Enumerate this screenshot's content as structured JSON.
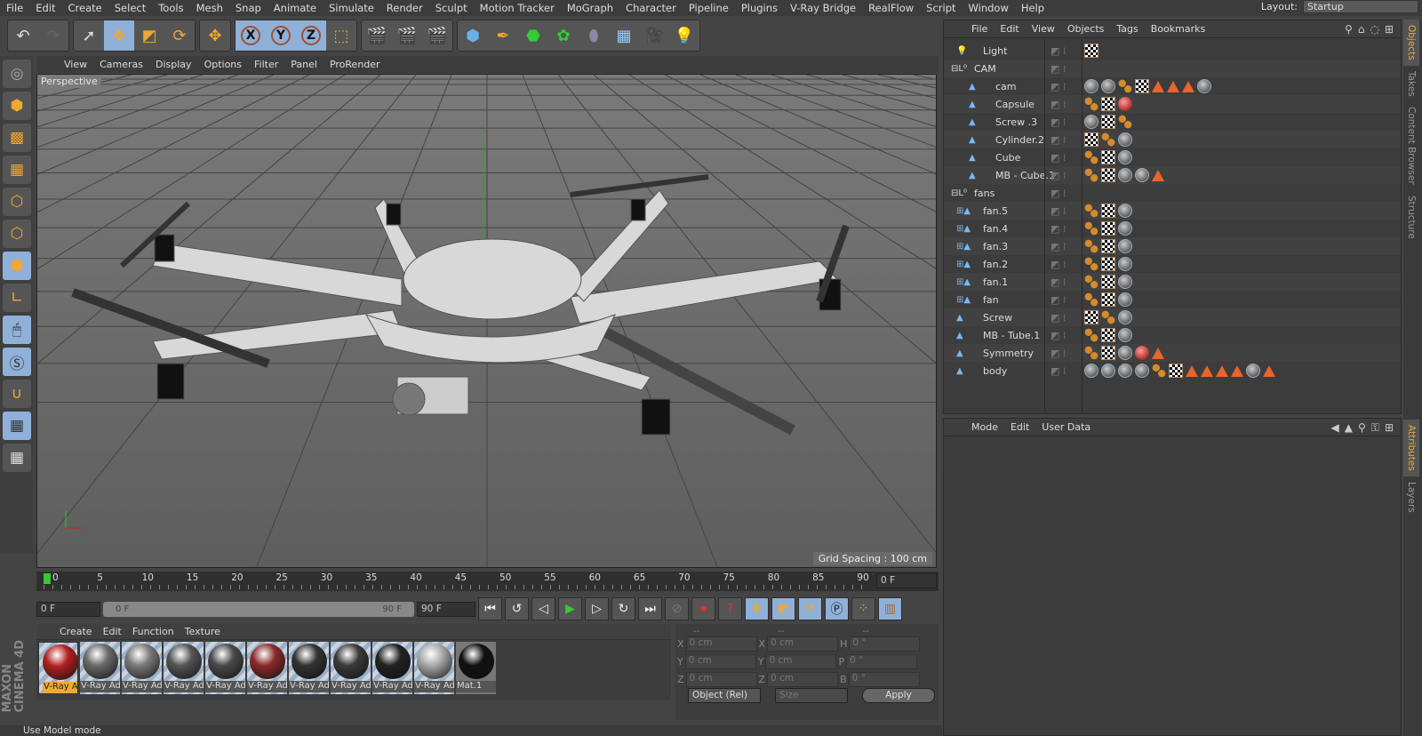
{
  "menu": [
    "File",
    "Edit",
    "Create",
    "Select",
    "Tools",
    "Mesh",
    "Snap",
    "Animate",
    "Simulate",
    "Render",
    "Sculpt",
    "Motion Tracker",
    "MoGraph",
    "Character",
    "Pipeline",
    "Plugins",
    "V-Ray Bridge",
    "RealFlow",
    "Script",
    "Window",
    "Help"
  ],
  "layout": {
    "label": "Layout:",
    "value": "Startup"
  },
  "toolbar": {
    "x": "X",
    "y": "Y",
    "z": "Z"
  },
  "viewport": {
    "menu": [
      "View",
      "Cameras",
      "Display",
      "Options",
      "Filter",
      "Panel",
      "ProRender"
    ],
    "camera": "Perspective",
    "grid_spacing": "Grid Spacing : 100 cm"
  },
  "timeline": {
    "ticks": [
      "0",
      "5",
      "10",
      "15",
      "20",
      "25",
      "30",
      "35",
      "40",
      "45",
      "50",
      "55",
      "60",
      "65",
      "70",
      "75",
      "80",
      "85",
      "90"
    ],
    "current": "0 F",
    "start": "0 F",
    "range_start": "0 F",
    "range_end": "90 F",
    "end": "90 F"
  },
  "materials": {
    "menu": [
      "Create",
      "Edit",
      "Function",
      "Texture"
    ],
    "items": [
      {
        "name": "V-Ray Ad",
        "color": "#b02020"
      },
      {
        "name": "V-Ray Ad",
        "color": "#6a6a6a"
      },
      {
        "name": "V-Ray Ad",
        "color": "#7a7a7a"
      },
      {
        "name": "V-Ray Ad",
        "color": "#555"
      },
      {
        "name": "V-Ray Ad",
        "color": "#4a4a4a"
      },
      {
        "name": "V-Ray Ad",
        "color": "#8a2a2a"
      },
      {
        "name": "V-Ray Ad",
        "color": "#333"
      },
      {
        "name": "V-Ray Ad",
        "color": "#3a3a3a"
      },
      {
        "name": "V-Ray Ad",
        "color": "#222"
      },
      {
        "name": "V-Ray Ad",
        "color": "#aaa"
      },
      {
        "name": "Mat.1",
        "color": "#111"
      }
    ]
  },
  "coords": {
    "headers": [
      "--",
      "--",
      "--"
    ],
    "rows": [
      {
        "a": "X",
        "av": "0 cm",
        "b": "X",
        "bv": "0 cm",
        "c": "H",
        "cv": "0 °"
      },
      {
        "a": "Y",
        "av": "0 cm",
        "b": "Y",
        "bv": "0 cm",
        "c": "P",
        "cv": "0 °"
      },
      {
        "a": "Z",
        "av": "0 cm",
        "b": "Z",
        "bv": "0 cm",
        "c": "B",
        "cv": "0 °"
      }
    ],
    "mode": "Object (Rel)",
    "size": "Size",
    "apply": "Apply"
  },
  "status": "Use Model mode",
  "objects": {
    "menu": [
      "File",
      "Edit",
      "View",
      "Objects",
      "Tags",
      "Bookmarks"
    ],
    "rows": [
      {
        "name": "Light",
        "indent": 1,
        "tags": [
          "chk"
        ]
      },
      {
        "name": "CAM",
        "indent": 0,
        "tags": []
      },
      {
        "name": "cam",
        "indent": 2,
        "tags": [
          "ball",
          "ball",
          "dots",
          "chk",
          "tri",
          "tri",
          "tri",
          "ball"
        ]
      },
      {
        "name": "Capsule",
        "indent": 2,
        "tags": [
          "dots",
          "chk",
          "red"
        ]
      },
      {
        "name": "Screw .3",
        "indent": 2,
        "tags": [
          "ball",
          "chk",
          "dots"
        ]
      },
      {
        "name": "Cylinder.2",
        "indent": 2,
        "tags": [
          "chk",
          "dots",
          "ball"
        ]
      },
      {
        "name": "Cube",
        "indent": 2,
        "tags": [
          "dots",
          "chk",
          "ball"
        ]
      },
      {
        "name": "MB - Cube.1",
        "indent": 2,
        "tags": [
          "dots",
          "chk",
          "ball",
          "ball",
          "tri"
        ]
      },
      {
        "name": "fans",
        "indent": 0,
        "tags": []
      },
      {
        "name": "fan.5",
        "indent": 1,
        "tags": [
          "dots",
          "chk",
          "ball"
        ]
      },
      {
        "name": "fan.4",
        "indent": 1,
        "tags": [
          "dots",
          "chk",
          "ball"
        ]
      },
      {
        "name": "fan.3",
        "indent": 1,
        "tags": [
          "dots",
          "chk",
          "ball"
        ]
      },
      {
        "name": "fan.2",
        "indent": 1,
        "tags": [
          "dots",
          "chk",
          "ball"
        ]
      },
      {
        "name": "fan.1",
        "indent": 1,
        "tags": [
          "dots",
          "chk",
          "ball"
        ]
      },
      {
        "name": "fan",
        "indent": 1,
        "tags": [
          "dots",
          "chk",
          "ball"
        ]
      },
      {
        "name": "Screw",
        "indent": 1,
        "tags": [
          "chk",
          "dots",
          "ball"
        ]
      },
      {
        "name": "MB - Tube.1",
        "indent": 1,
        "tags": [
          "dots",
          "chk",
          "ball"
        ]
      },
      {
        "name": "Symmetry",
        "indent": 1,
        "tags": [
          "dots",
          "chk",
          "ball",
          "red",
          "tri"
        ]
      },
      {
        "name": "body",
        "indent": 1,
        "tags": [
          "ball",
          "ball",
          "ball",
          "ball",
          "dots",
          "chk",
          "tri",
          "tri",
          "tri",
          "tri",
          "ball",
          "tri"
        ]
      }
    ]
  },
  "attributes": {
    "menu": [
      "Mode",
      "Edit",
      "User Data"
    ]
  },
  "right_tabs": [
    "Objects",
    "Takes",
    "Content Browser",
    "Structure"
  ],
  "right_tabs2": [
    "Attributes",
    "Layers"
  ],
  "logo": "MAXON CINEMA 4D"
}
